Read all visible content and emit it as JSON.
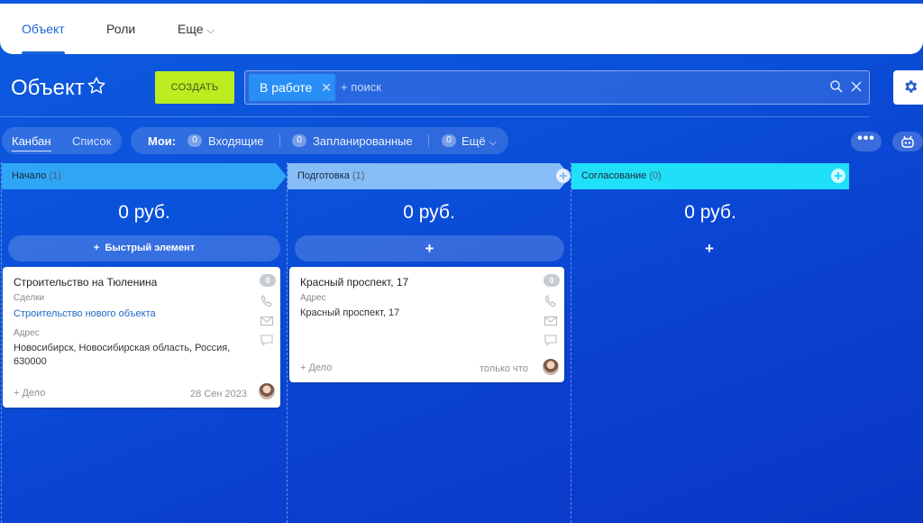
{
  "top_tabs": [
    {
      "label": "Объект"
    },
    {
      "label": "Роли"
    },
    {
      "label": "Еще"
    }
  ],
  "header": {
    "title": "Объект",
    "create_label": "СОЗДАТЬ",
    "filter_chip": "В работе",
    "search_placeholder": "+ поиск"
  },
  "view_switch": {
    "kanban": "Канбан",
    "list": "Список"
  },
  "my_filters": {
    "label": "Мои:",
    "items": [
      {
        "count": "0",
        "label": "Входящие"
      },
      {
        "count": "0",
        "label": "Запланированные"
      },
      {
        "count": "0",
        "label": "Ещё"
      }
    ]
  },
  "columns": [
    {
      "name": "Начало",
      "count": "(1)",
      "sum": "0 руб.",
      "color": "#2fa6f5",
      "quick_add": "Быстрый элемент"
    },
    {
      "name": "Подготовка",
      "count": "(1)",
      "sum": "0 руб.",
      "color": "#86bdf7",
      "quick_add": "+"
    },
    {
      "name": "Согласование",
      "count": "(0)",
      "sum": "0 руб.",
      "color": "#1fe0f8",
      "quick_add": "+"
    }
  ],
  "cards": [
    {
      "title": "Строительство на Тюленина",
      "counter": "0",
      "deal_label": "Сделки",
      "deal_link": "Строительство нового объекта",
      "address_label": "Адрес",
      "address_line1": "Новосибирск, Новосибирская область, Россия,",
      "address_line2": "630000",
      "add_task": "+ Дело",
      "date": "28 Сен 2023"
    },
    {
      "title": "Красный проспект, 17",
      "counter": "0",
      "address_label": "Адрес",
      "address_line1": "Красный проспект, 17",
      "add_task": "+ Дело",
      "date": "только что"
    }
  ],
  "icons": {
    "star": "star-icon",
    "search": "search-icon",
    "clear": "close-icon",
    "settings": "gear-icon",
    "robot": "robot-icon",
    "phone": "phone-icon",
    "mail": "mail-icon",
    "chat": "chat-icon"
  }
}
